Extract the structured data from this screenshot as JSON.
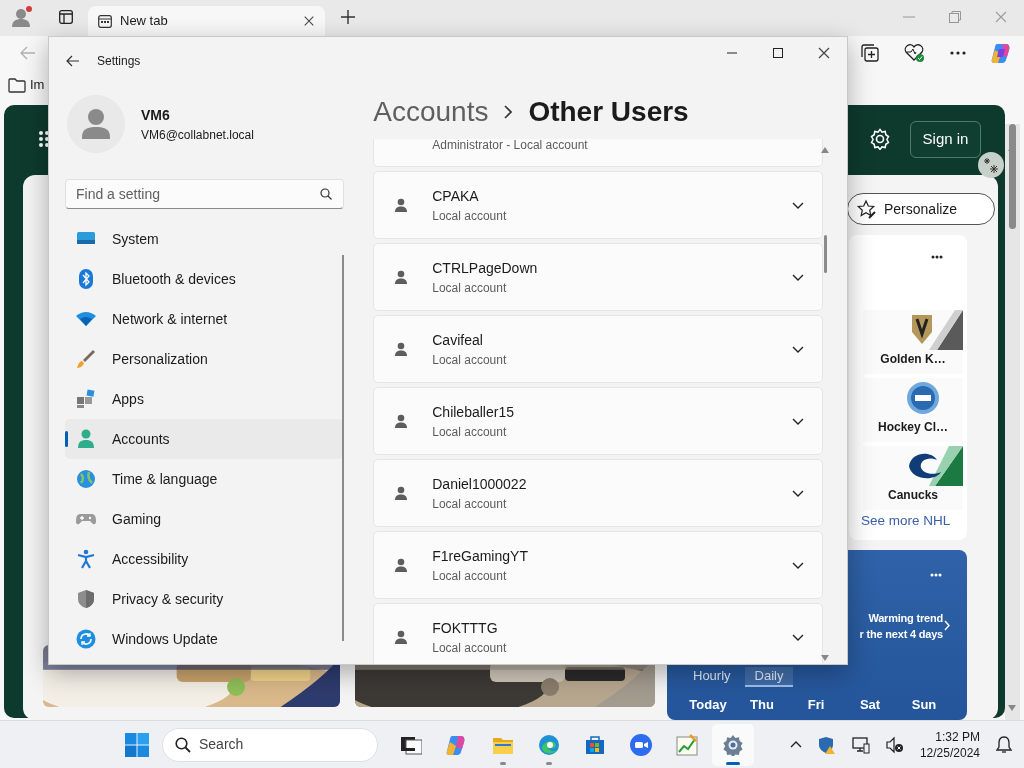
{
  "browser": {
    "tab": {
      "title": "New tab"
    },
    "bookmark": {
      "label": "Im"
    }
  },
  "newtab": {
    "sign_in": "Sign in",
    "personalize": "Personalize",
    "nhl": {
      "teams": [
        "Golden K…",
        "Hockey Cl…",
        "Canucks"
      ],
      "see_more": "See more NHL"
    },
    "weather": {
      "headline": "Warming trend",
      "subline": "r the next 4 days",
      "tabs": [
        {
          "label": "Hourly",
          "selected": false
        },
        {
          "label": "Daily",
          "selected": true
        }
      ],
      "days": [
        "Today",
        "Thu",
        "Fri",
        "Sat",
        "Sun"
      ]
    }
  },
  "settings": {
    "title": "Settings",
    "user": {
      "name": "VM6",
      "email": "VM6@collabnet.local"
    },
    "search": {
      "placeholder": "Find a setting"
    },
    "nav": [
      {
        "label": "System",
        "kind": "system",
        "selected": false
      },
      {
        "label": "Bluetooth & devices",
        "kind": "bluetooth",
        "selected": false
      },
      {
        "label": "Network & internet",
        "kind": "network",
        "selected": false
      },
      {
        "label": "Personalization",
        "kind": "brush",
        "selected": false
      },
      {
        "label": "Apps",
        "kind": "apps",
        "selected": false
      },
      {
        "label": "Accounts",
        "kind": "accounts",
        "selected": true
      },
      {
        "label": "Time & language",
        "kind": "time",
        "selected": false
      },
      {
        "label": "Gaming",
        "kind": "gaming",
        "selected": false
      },
      {
        "label": "Accessibility",
        "kind": "accessibility",
        "selected": false
      },
      {
        "label": "Privacy & security",
        "kind": "privacy",
        "selected": false
      },
      {
        "label": "Windows Update",
        "kind": "update",
        "selected": false
      }
    ],
    "breadcrumb": [
      "Accounts",
      "Other Users"
    ],
    "partial_user": {
      "subtitle": "Administrator - Local account"
    },
    "users": [
      {
        "name": "CPAKA",
        "subtitle": "Local account"
      },
      {
        "name": "CTRLPageDown",
        "subtitle": "Local account"
      },
      {
        "name": "Cavifeal",
        "subtitle": "Local account"
      },
      {
        "name": "Chileballer15",
        "subtitle": "Local account"
      },
      {
        "name": "Daniel1000022",
        "subtitle": "Local account"
      },
      {
        "name": "F1reGamingYT",
        "subtitle": "Local account"
      },
      {
        "name": "FOKTTTG",
        "subtitle": "Local account"
      }
    ]
  },
  "taskbar": {
    "search": "Search",
    "apps": [
      {
        "kind": "taskview",
        "running": false,
        "selected": false
      },
      {
        "kind": "copilot",
        "running": false,
        "selected": false
      },
      {
        "kind": "explorer",
        "running": true,
        "selected": false
      },
      {
        "kind": "edge",
        "running": true,
        "selected": false
      },
      {
        "kind": "store",
        "running": false,
        "selected": false
      },
      {
        "kind": "zoom",
        "running": false,
        "selected": false
      },
      {
        "kind": "chart",
        "running": false,
        "selected": false
      },
      {
        "kind": "settings",
        "running": true,
        "selected": true
      }
    ],
    "time": "1:32 PM",
    "date": "12/25/2024"
  }
}
